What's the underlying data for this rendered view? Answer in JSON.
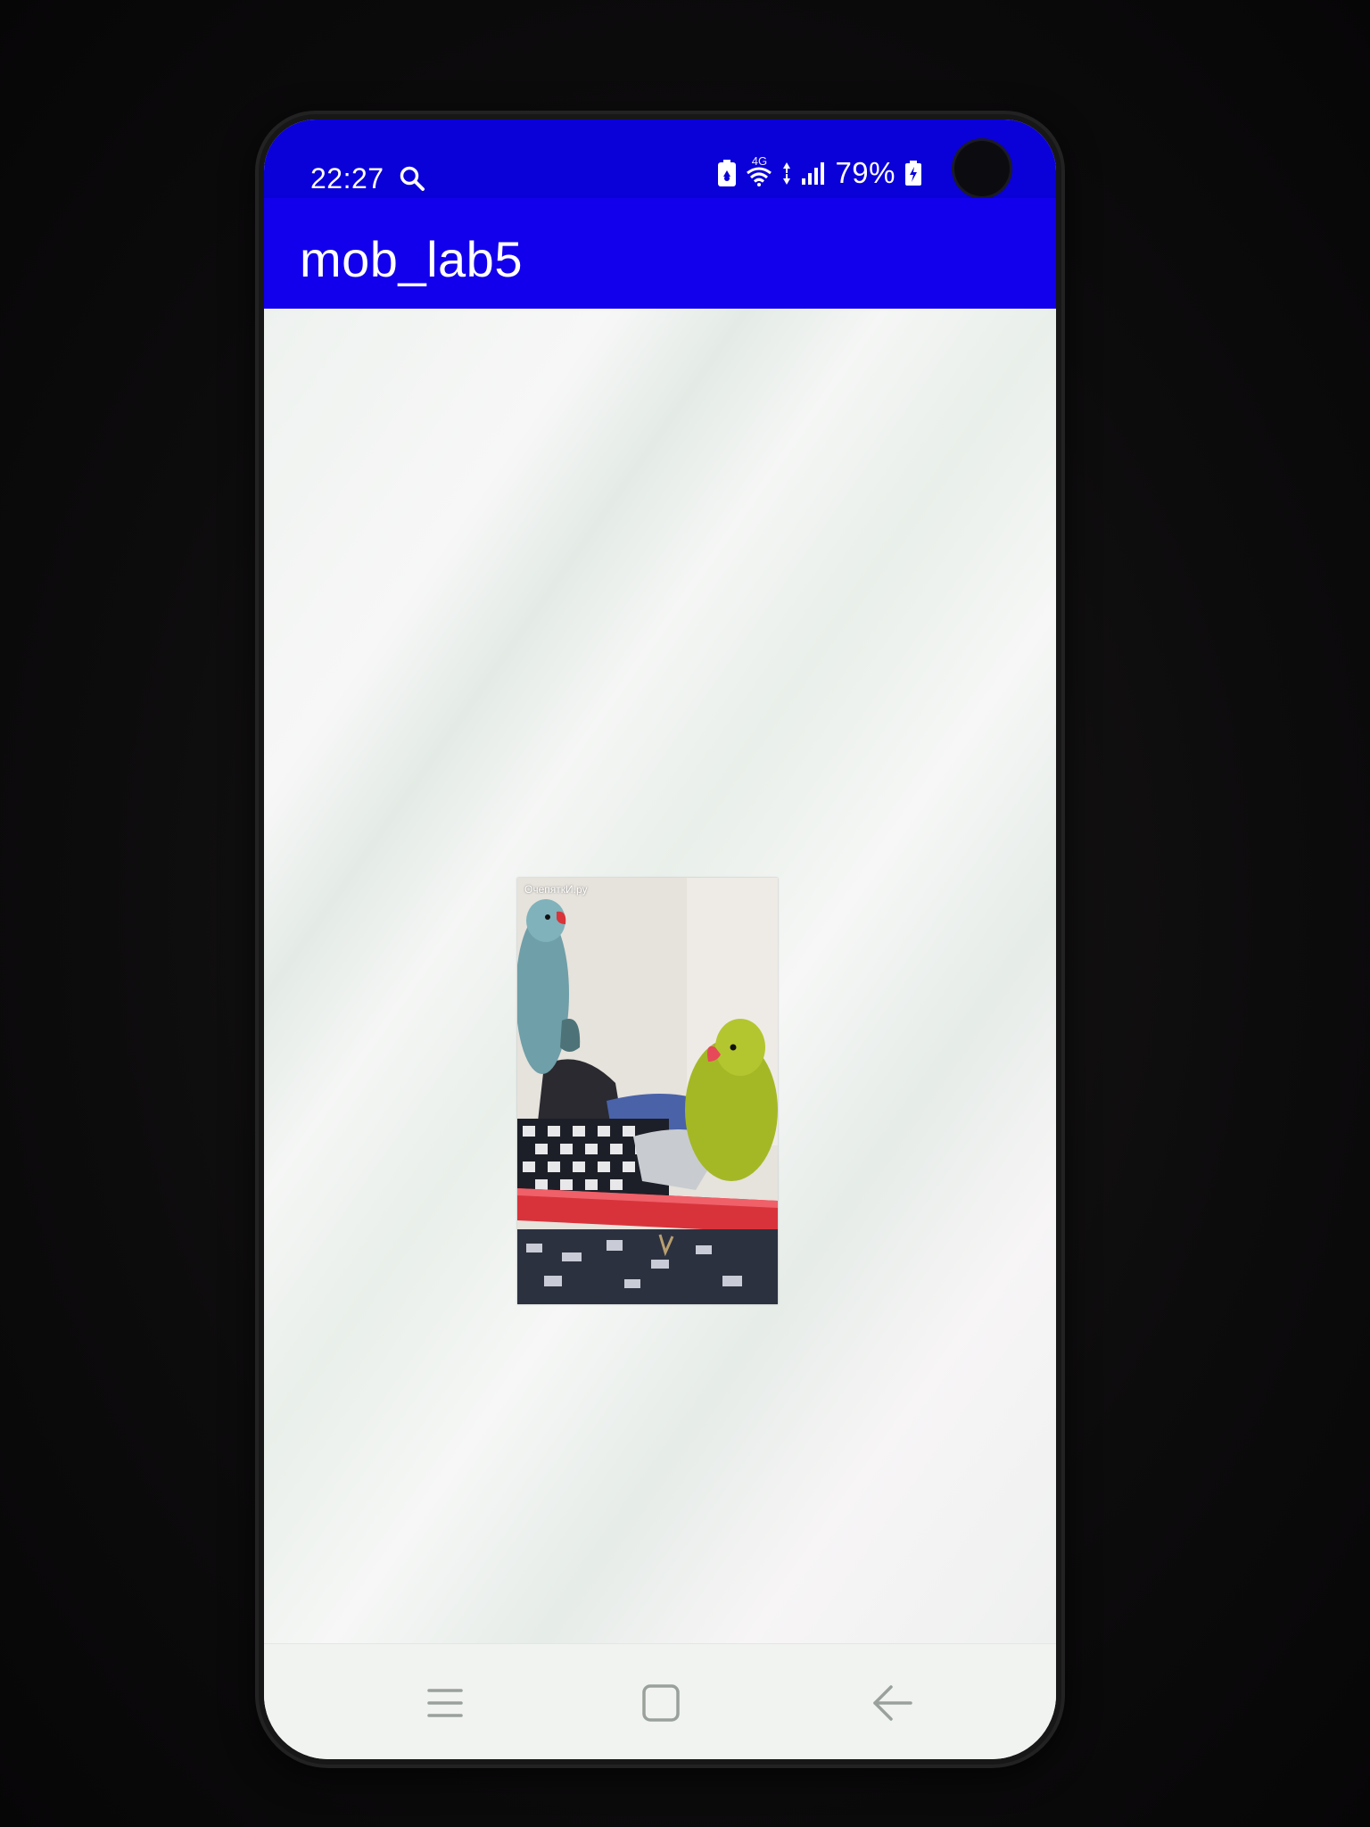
{
  "status_bar": {
    "time": "22:27",
    "network_type": "4G",
    "battery_percent": "79%",
    "icons": [
      "search-icon",
      "battery-saver-icon",
      "wifi-icon",
      "data-arrows-icon",
      "signal-icon",
      "battery-charging-icon"
    ]
  },
  "app_bar": {
    "title": "mob_lab5"
  },
  "content": {
    "image_watermark": "ОчепяткИ.ру",
    "image_subject": "two parrots"
  },
  "nav_bar": {
    "icons": [
      "recent-apps-icon",
      "home-icon",
      "back-icon"
    ]
  },
  "colors": {
    "status_bar": "#0a00d8",
    "app_bar": "#1200ec",
    "background": "#f2f4f2",
    "nav_icons": "#9aa19c"
  }
}
